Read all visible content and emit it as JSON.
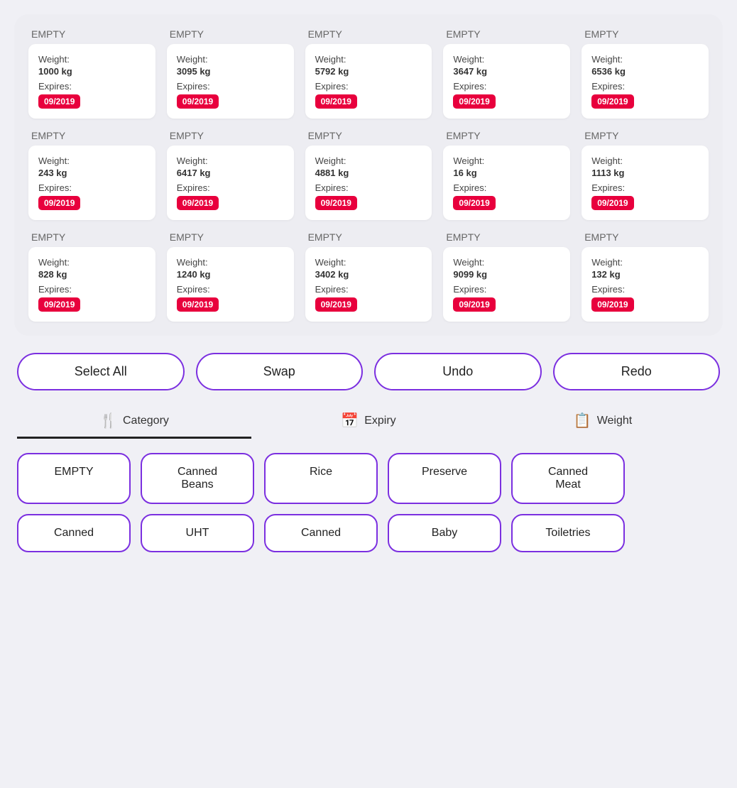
{
  "grid": {
    "rows": [
      [
        {
          "label": "EMPTY",
          "weight": "1000 kg",
          "expires": "09/2019"
        },
        {
          "label": "EMPTY",
          "weight": "3095 kg",
          "expires": "09/2019"
        },
        {
          "label": "EMPTY",
          "weight": "5792 kg",
          "expires": "09/2019"
        },
        {
          "label": "EMPTY",
          "weight": "3647 kg",
          "expires": "09/2019"
        },
        {
          "label": "EMPTY",
          "weight": "6536 kg",
          "expires": "09/2019"
        }
      ],
      [
        {
          "label": "EMPTY",
          "weight": "243 kg",
          "expires": "09/2019"
        },
        {
          "label": "EMPTY",
          "weight": "6417 kg",
          "expires": "09/2019"
        },
        {
          "label": "EMPTY",
          "weight": "4881 kg",
          "expires": "09/2019"
        },
        {
          "label": "EMPTY",
          "weight": "16 kg",
          "expires": "09/2019"
        },
        {
          "label": "EMPTY",
          "weight": "1113 kg",
          "expires": "09/2019"
        }
      ],
      [
        {
          "label": "EMPTY",
          "weight": "828 kg",
          "expires": "09/2019"
        },
        {
          "label": "EMPTY",
          "weight": "1240 kg",
          "expires": "09/2019"
        },
        {
          "label": "EMPTY",
          "weight": "3402 kg",
          "expires": "09/2019"
        },
        {
          "label": "EMPTY",
          "weight": "9099 kg",
          "expires": "09/2019"
        },
        {
          "label": "EMPTY",
          "weight": "132 kg",
          "expires": "09/2019"
        }
      ]
    ],
    "weight_label": "Weight:",
    "expires_label": "Expires:"
  },
  "actions": {
    "select_all": "Select All",
    "swap": "Swap",
    "undo": "Undo",
    "redo": "Redo"
  },
  "sort_tabs": [
    {
      "label": "Category",
      "icon": "🍴",
      "active": true
    },
    {
      "label": "Expiry",
      "icon": "📅",
      "active": false
    },
    {
      "label": "Weight",
      "icon": "📋",
      "active": false
    }
  ],
  "chips_row1": [
    {
      "label": "EMPTY"
    },
    {
      "label": "Canned\nBeans"
    },
    {
      "label": "Rice"
    },
    {
      "label": "Preserve"
    },
    {
      "label": "Canned\nMeat"
    }
  ],
  "chips_row2": [
    {
      "label": "Canned"
    },
    {
      "label": "UHT"
    },
    {
      "label": "Canned"
    },
    {
      "label": "Baby"
    },
    {
      "label": "Toiletries"
    }
  ]
}
